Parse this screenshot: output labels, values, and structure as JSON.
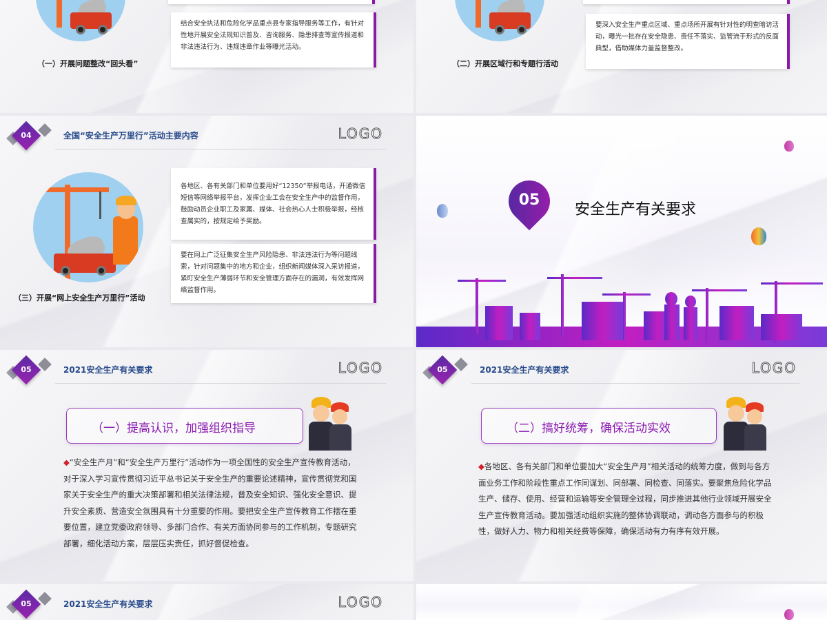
{
  "slide_top_left": {
    "box_text": "结合安全执法和危险化学品重点县专家指导服务等工作，有针对性地开展安全法规知识普及、咨询服务、隐患排查等宣传报道和非法违法行为、违规违章作业等曝光活动。",
    "caption": "（一）开展问题整改“回头看”"
  },
  "slide_top_right": {
    "box_text": "要深入安全生产重点区域、重点场所开展有针对性的明查暗访活动，曝光一批存在安全隐患、责任不落实、监管流于形式的反面典型，借助媒体力量监督整改。",
    "caption": "（二）开展区域行和专题行活动"
  },
  "slide_04": {
    "badge": "04",
    "title": "全国“安全生产万里行”活动主要内容",
    "logo": "LOGO",
    "box1_text": "各地区、各有关部门和单位要用好“12350”举报电话，开通微信短信等网络举报平台，发挥企业工会在安全生产中的监督作用，鼓励动员企业职工及家属、媒体、社会热心人士积极举报，经核查属实的，按规定给予奖励。",
    "box2_text": "要在网上广泛征集安全生产风险隐患、非法违法行为等问题线索，针对问题集中的地方和企业，组织新闻媒体深入采访报道，紧盯安全生产薄弱环节和安全管理方面存在的漏洞，有效发挥网络监督作用。",
    "caption": "（三）开展“网上安全生产万里行”活动"
  },
  "slide_05_cover": {
    "number": "05",
    "title": "安全生产有关要求"
  },
  "slide_05a": {
    "badge": "05",
    "title": "2021安全生产有关要求",
    "logo": "LOGO",
    "heading": "（一）提高认识，加强组织指导",
    "bullet": "◆",
    "paragraph": "“安全生产月”和“安全生产万里行”活动作为一项全国性的安全生产宣传教育活动，对于深入学习宣传贯彻习近平总书记关于安全生产的重要论述精神，宣传贯彻党和国家关于安全生产的重大决策部署和相关法律法规，普及安全知识、强化安全意识、提升安全素质、营造安全氛围具有十分重要的作用。要把安全生产宣传教育工作摆在重要位置，建立党委政府领导、多部门合作、有关方面协同参与的工作机制，专题研究部署，细化活动方案，层层压实责任，抓好督促检查。"
  },
  "slide_05b": {
    "badge": "05",
    "title": "2021安全生产有关要求",
    "logo": "LOGO",
    "heading": "（二）搞好统筹，确保活动实效",
    "bullet": "◆",
    "paragraph": "各地区、各有关部门和单位要加大“安全生产月”相关活动的统筹力度，做到与各方面业务工作和阶段性重点工作同谋划、同部署、同检查、同落实。要聚焦危险化学品生产、储存、使用、经营和运输等安全管理全过程，同步推进其他行业领域开展安全生产宣传教育活动。要加强活动组织实施的整体协调联动，调动各方面参与的积极性，做好人力、物力和相关经费等保障，确保活动有力有序有效开展。"
  },
  "slide_05c": {
    "badge": "05",
    "title": "2021安全生产有关要求",
    "logo": "LOGO"
  },
  "colors": {
    "accent": "#8a1aa6",
    "title_blue": "#274a8a",
    "bullet_red": "#d0202a"
  }
}
